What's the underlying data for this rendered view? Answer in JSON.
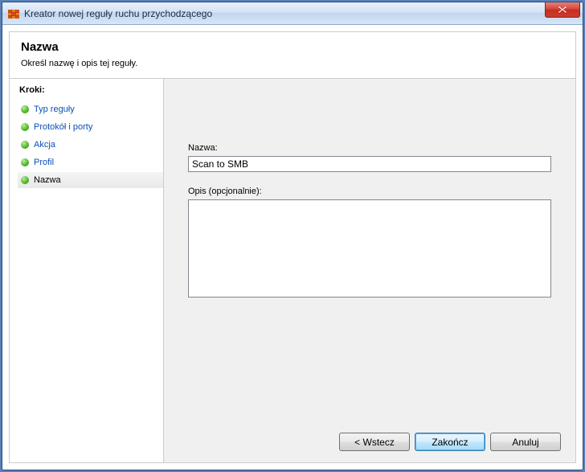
{
  "window": {
    "title": "Kreator nowej reguły ruchu przychodzącego"
  },
  "header": {
    "title": "Nazwa",
    "subtitle": "Określ nazwę i opis tej reguły."
  },
  "sidebar": {
    "steps_label": "Kroki:",
    "items": [
      {
        "label": "Typ reguły"
      },
      {
        "label": "Protokół i porty"
      },
      {
        "label": "Akcja"
      },
      {
        "label": "Profil"
      },
      {
        "label": "Nazwa"
      }
    ]
  },
  "form": {
    "name_label": "Nazwa:",
    "name_value": "Scan to SMB",
    "desc_label": "Opis (opcjonalnie):",
    "desc_value": ""
  },
  "buttons": {
    "back": "< Wstecz",
    "finish": "Zakończ",
    "cancel": "Anuluj"
  }
}
